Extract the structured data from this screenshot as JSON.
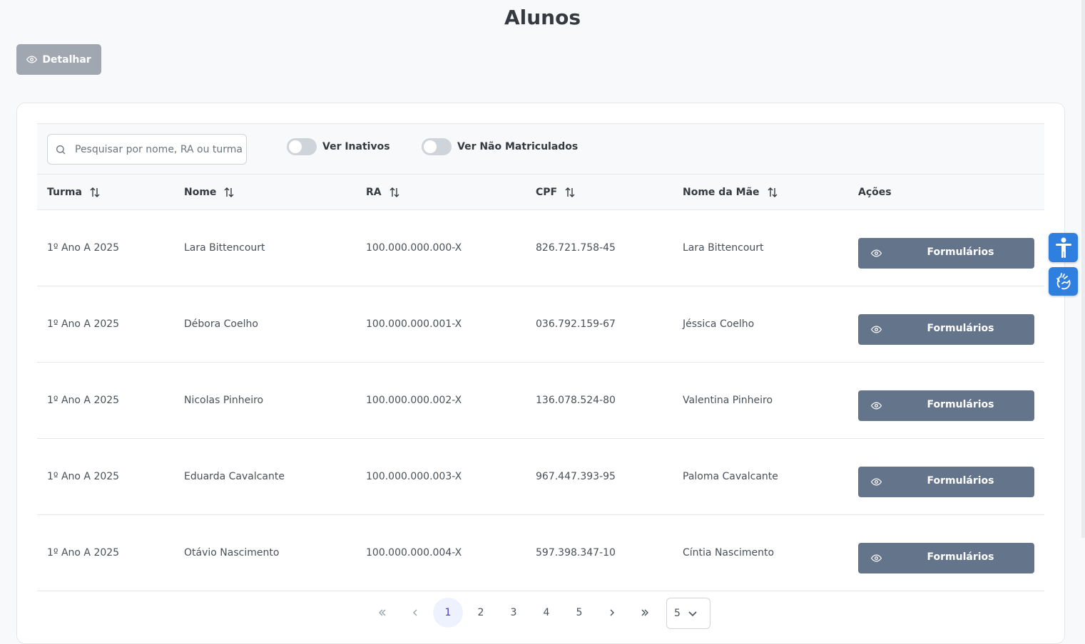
{
  "page": {
    "title": "Alunos"
  },
  "toolbar": {
    "detail_label": "Detalhar"
  },
  "filters": {
    "search_placeholder": "Pesquisar por nome, RA ou turma",
    "toggle_inactive_label": "Ver Inativos",
    "toggle_not_enrolled_label": "Ver Não Matriculados"
  },
  "table": {
    "columns": [
      "Turma",
      "Nome",
      "RA",
      "CPF",
      "Nome da Mãe",
      "Ações"
    ],
    "action_label": "Formulários",
    "rows": [
      {
        "turma": "1º Ano A 2025",
        "nome": "Lara Bittencourt",
        "ra": "100.000.000.000-X",
        "cpf": "826.721.758-45",
        "mae": "Lara Bittencourt"
      },
      {
        "turma": "1º Ano A 2025",
        "nome": "Débora Coelho",
        "ra": "100.000.000.001-X",
        "cpf": "036.792.159-67",
        "mae": "Jéssica Coelho"
      },
      {
        "turma": "1º Ano A 2025",
        "nome": "Nicolas Pinheiro",
        "ra": "100.000.000.002-X",
        "cpf": "136.078.524-80",
        "mae": "Valentina Pinheiro"
      },
      {
        "turma": "1º Ano A 2025",
        "nome": "Eduarda Cavalcante",
        "ra": "100.000.000.003-X",
        "cpf": "967.447.393-95",
        "mae": "Paloma Cavalcante"
      },
      {
        "turma": "1º Ano A 2025",
        "nome": "Otávio Nascimento",
        "ra": "100.000.000.004-X",
        "cpf": "597.398.347-10",
        "mae": "Cíntia Nascimento"
      }
    ]
  },
  "pagination": {
    "pages": [
      "1",
      "2",
      "3",
      "4",
      "5"
    ],
    "current": "1",
    "rows_per_page": "5"
  },
  "colors": {
    "action_button": "#64748b",
    "accessibility": "#2f7fe0",
    "active_page": "#4338ca"
  },
  "icons": [
    "eye-icon",
    "search-icon",
    "sort-icon",
    "accessibility-icon",
    "sign-language-icon",
    "chevron-down-icon"
  ]
}
